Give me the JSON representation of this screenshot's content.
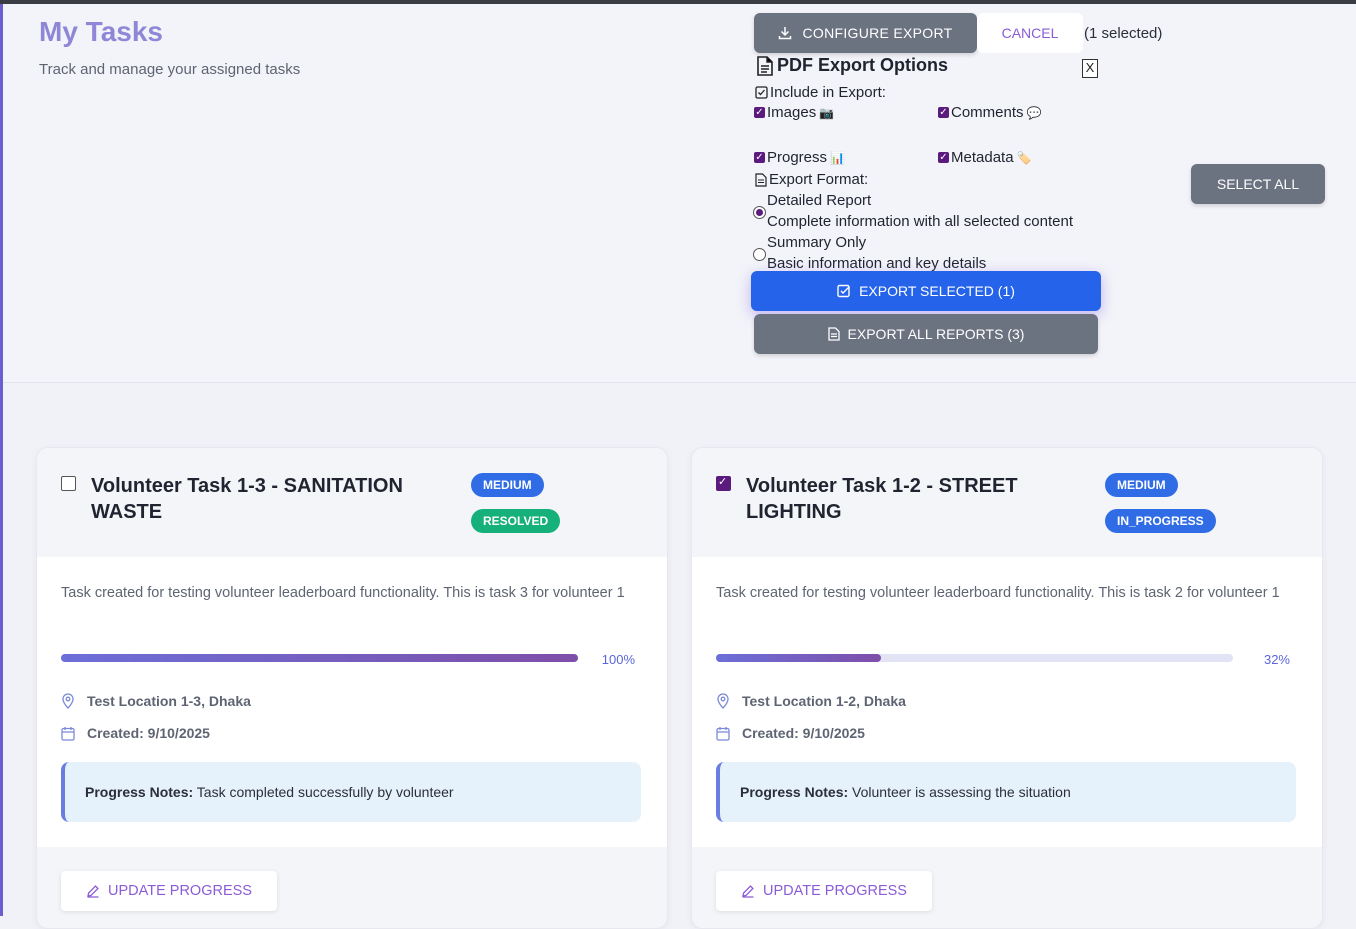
{
  "header": {
    "title": "My Tasks",
    "subtitle": "Track and manage your assigned tasks"
  },
  "toolbar": {
    "configure_export_label": "CONFIGURE EXPORT",
    "cancel_label": "CANCEL",
    "selected_count_text": "(1 selected)",
    "select_all_label": "SELECT ALL",
    "export_selected_label": "EXPORT SELECTED (1)",
    "export_all_label": "EXPORT ALL REPORTS (3)"
  },
  "export_options": {
    "title": "PDF Export Options",
    "close_label": "X",
    "include_label": "Include in Export:",
    "include_items": [
      {
        "label": "Images",
        "emoji": "📷",
        "checked": true
      },
      {
        "label": "Comments",
        "emoji": "💬",
        "checked": true
      },
      {
        "label": "Progress",
        "emoji": "📊",
        "checked": true
      },
      {
        "label": "Metadata",
        "emoji": "🏷️",
        "checked": true
      }
    ],
    "format_label": "Export Format:",
    "formats": [
      {
        "title": "Detailed Report",
        "description": "Complete information with all selected content",
        "selected": true
      },
      {
        "title": "Summary Only",
        "description": "Basic information and key details",
        "selected": false
      }
    ]
  },
  "tasks": [
    {
      "selected": false,
      "title": "Volunteer Task 1-3 - SANITATION WASTE",
      "priority": "MEDIUM",
      "status": "RESOLVED",
      "description": "Task created for testing volunteer leaderboard functionality. This is task 3 for volunteer 1",
      "progress": 100,
      "progress_label": "100%",
      "location": "Test Location 1-3, Dhaka",
      "created": "Created: 9/10/2025",
      "notes_label": "Progress Notes:",
      "notes": "Task completed successfully by volunteer",
      "update_label": "UPDATE PROGRESS"
    },
    {
      "selected": true,
      "title": "Volunteer Task 1-2 - STREET LIGHTING",
      "priority": "MEDIUM",
      "status": "IN_PROGRESS",
      "description": "Task created for testing volunteer leaderboard functionality. This is task 2 for volunteer 1",
      "progress": 32,
      "progress_label": "32%",
      "location": "Test Location 1-2, Dhaka",
      "created": "Created: 9/10/2025",
      "notes_label": "Progress Notes:",
      "notes": "Volunteer is assessing the situation",
      "update_label": "UPDATE PROGRESS"
    }
  ],
  "colors": {
    "primary": "#2563eb",
    "gray_button": "#6b7280",
    "badge_medium": "#2f6ce5",
    "badge_resolved": "#16b07a",
    "badge_in_progress": "#2f6ce5",
    "accent_purple": "#8a5cd6"
  }
}
